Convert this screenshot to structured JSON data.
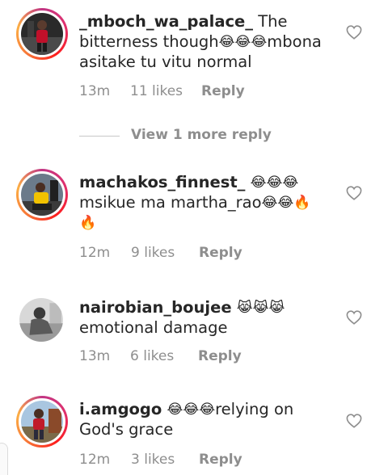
{
  "comments": [
    {
      "username": "_mboch_wa_palace_",
      "text_parts": [
        "The bitterness though",
        "😂😂😂",
        "mbona asitake tu vitu normal"
      ],
      "time": "13m",
      "likes": "11 likes",
      "reply": "Reply",
      "avatar": "avatar-person-red-shirt",
      "has_story_ring": true
    },
    {
      "username": "machakos_finnest_",
      "text_parts": [
        "😂😂😂",
        "msikue ma martha_rao",
        "😂😂🔥",
        "🔥"
      ],
      "time": "12m",
      "likes": "9 likes",
      "reply": "Reply",
      "avatar": "avatar-person-yellow-jacket",
      "has_story_ring": true
    },
    {
      "username": "nairobian_boujee",
      "text_parts": [
        "😹😹😹",
        "emotional damage"
      ],
      "time": "13m",
      "likes": "6 likes",
      "reply": "Reply",
      "avatar": "avatar-person-monochrome",
      "has_story_ring": false
    },
    {
      "username": "i.amgogo",
      "text_parts": [
        "😂😂😂",
        "relying on God's grace"
      ],
      "time": "12m",
      "likes": "3 likes",
      "reply": "Reply",
      "avatar": "avatar-person-outdoor",
      "has_story_ring": true
    }
  ],
  "view_more_replies": "View 1 more reply",
  "icons": {
    "like": "heart-outline-icon"
  },
  "colors": {
    "text": "#262626",
    "secondary": "#8e8e8e",
    "ring_start": "#c13584",
    "ring_end": "#fcaf45"
  }
}
